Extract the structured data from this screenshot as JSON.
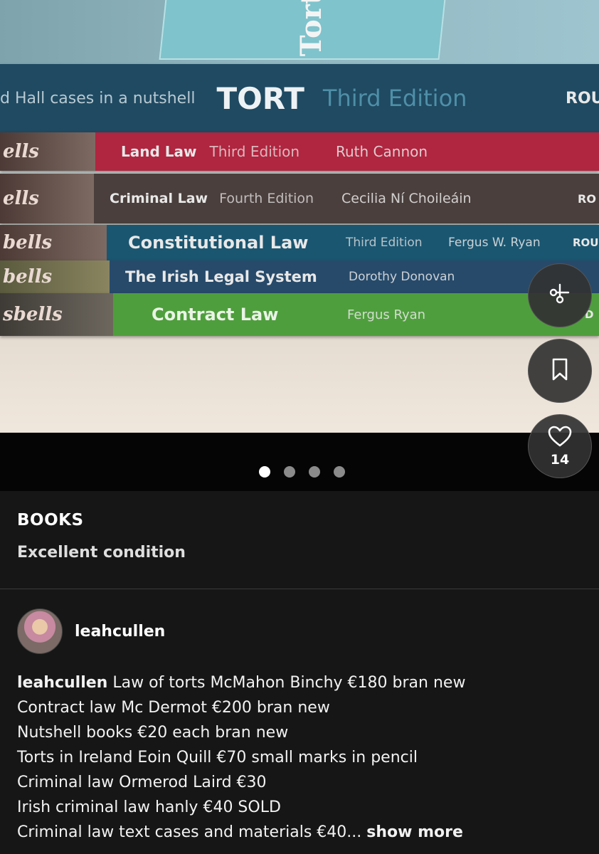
{
  "photo": {
    "cover_title": "Tort",
    "spines": [
      {
        "edge": "",
        "pre": "d Hall cases in a nutshell",
        "title": "TORT",
        "edition": "Third Edition",
        "author": "",
        "tail": "ROU"
      },
      {
        "edge": "ells",
        "pre": "",
        "title": "Land Law",
        "edition": "Third Edition",
        "author": "Ruth Cannon",
        "tail": ""
      },
      {
        "edge": "ells",
        "pre": "",
        "title": "Criminal Law",
        "edition": "Fourth Edition",
        "author": "Cecilia Ní Choileáin",
        "tail": "RO"
      },
      {
        "edge": "bells",
        "pre": "",
        "title": "Constitutional Law",
        "edition": "Third Edition",
        "author": "Fergus W. Ryan",
        "tail": "ROU"
      },
      {
        "edge": "bells",
        "pre": "",
        "title": "The Irish Legal System",
        "edition": "",
        "author": "Dorothy Donovan",
        "tail": ""
      },
      {
        "edge": "sbells",
        "pre": "",
        "title": "Contract Law",
        "edition": "",
        "author": "Fergus Ryan",
        "tail": "D"
      }
    ]
  },
  "carousel": {
    "count": 4,
    "active": 0
  },
  "actions": {
    "like_count": "14"
  },
  "post": {
    "title": "BOOKS",
    "condition": "Excellent condition"
  },
  "seller": {
    "username": "leahcullen"
  },
  "description": {
    "username": "leahcullen",
    "lines": [
      "Law of torts McMahon Binchy €180 bran new",
      "Contract law Mc Dermot €200 bran new",
      "Nutshell books €20 each bran new",
      "Torts in Ireland Eoin Quill €70 small marks in pencil",
      "Criminal law Ormerod Laird €30",
      "Irish criminal law hanly €40 SOLD",
      "Criminal law text cases and materials €40..."
    ],
    "show_more": "show more"
  }
}
